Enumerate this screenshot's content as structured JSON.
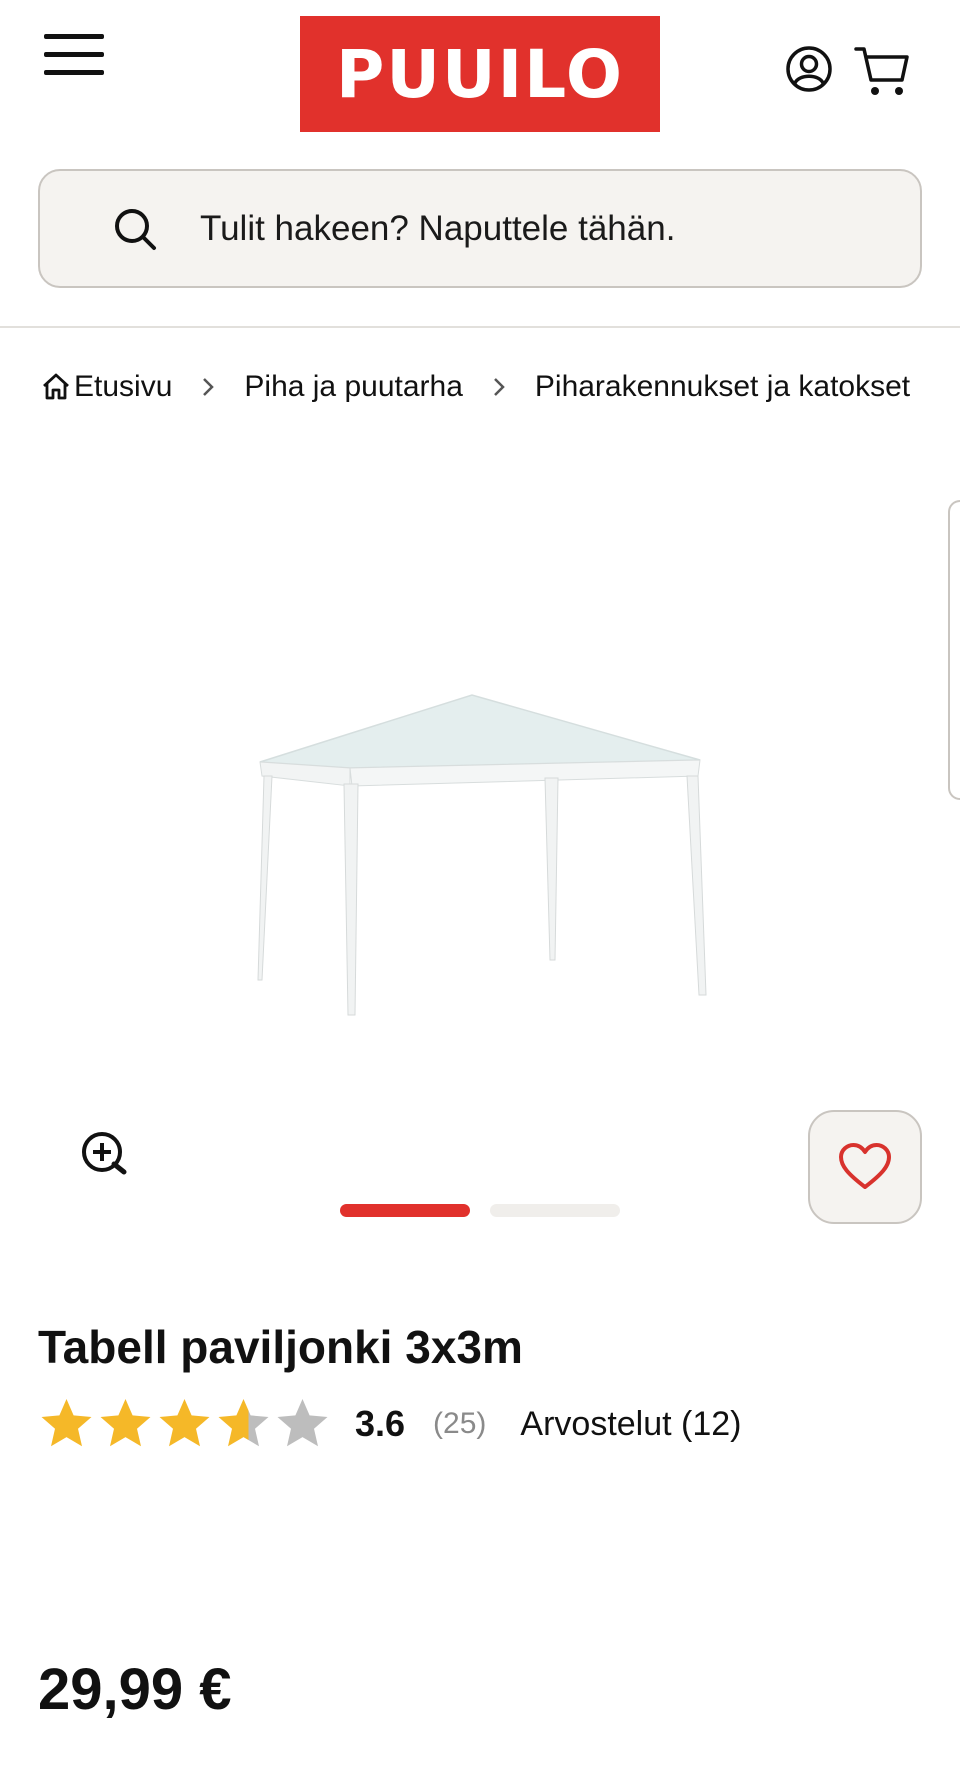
{
  "header": {
    "logo_text": "PUUILO",
    "brand_color": "#e1312c",
    "menu_icon": "hamburger-menu-icon",
    "account_icon": "user-account-icon",
    "cart_icon": "shopping-cart-icon"
  },
  "search": {
    "icon": "search-icon",
    "placeholder": "Tulit hakeen? Naputtele tähän."
  },
  "breadcrumb": {
    "items": [
      "Etusivu",
      "Piha ja puutarha",
      "Piharakennukset ja katokset"
    ]
  },
  "gallery": {
    "image_count": 2,
    "active_index": 0,
    "active_color": "#e1312c",
    "inactive_color": "#f0eeeb",
    "zoom_icon": "zoom-in-icon",
    "favorite_icon": "heart-icon"
  },
  "product": {
    "title": "Tabell paviljonki 3x3m",
    "rating": 3.6,
    "rating_max": 5,
    "rating_label": "3.6",
    "rating_count": "(25)",
    "reviews_label": "Arvostelut (12)",
    "star_color": "#f5b828",
    "star_empty_color": "#bdbdbd",
    "price": "29,99 €"
  }
}
